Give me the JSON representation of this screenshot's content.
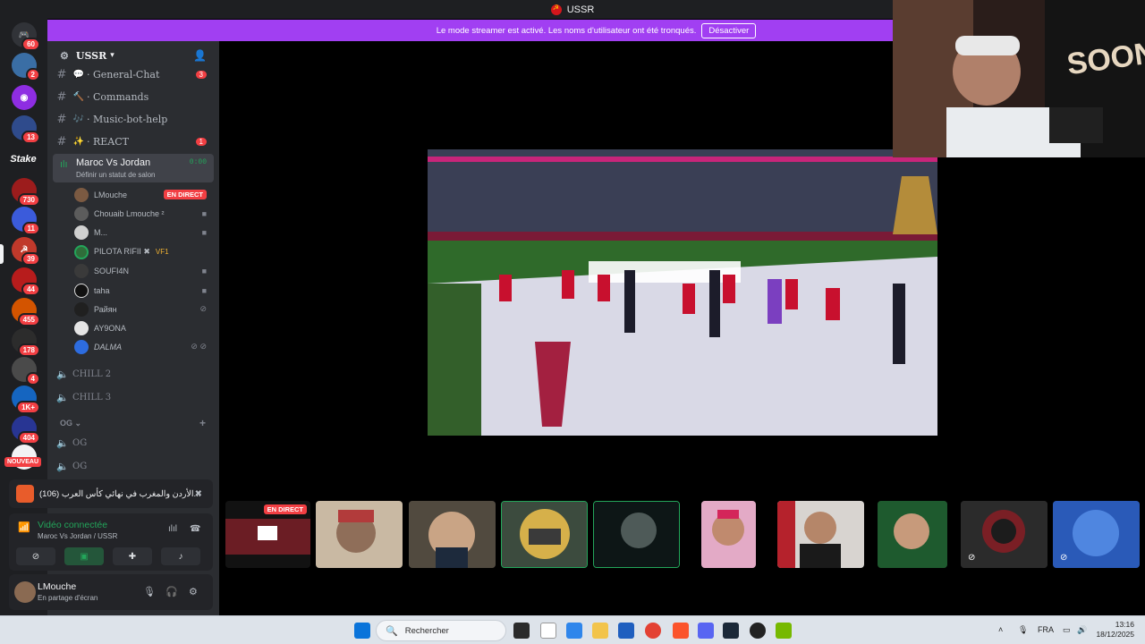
{
  "window": {
    "title": "USSR"
  },
  "banner": {
    "text": "Le mode streamer est activé. Les noms d'utilisateur ont été tronqués.",
    "button": "Désactiver"
  },
  "rail": {
    "badges": [
      "60",
      "2",
      "13",
      "730",
      "11",
      "39",
      "44",
      "455",
      "178",
      "4",
      "1K+",
      "404"
    ],
    "stake": "Stake",
    "new_label": "NOUVEAU"
  },
  "server": {
    "name": "USSR"
  },
  "channels": [
    {
      "emoji": "💬",
      "name": "· General-Chat",
      "count": "3"
    },
    {
      "emoji": "🔨",
      "name": "· Commands",
      "count": ""
    },
    {
      "emoji": "🎶",
      "name": "· Music-bot-help",
      "count": ""
    },
    {
      "emoji": "✨",
      "name": "· REACT",
      "count": "1"
    }
  ],
  "voice": {
    "name": "Maroc Vs Jordan",
    "time": "0:00",
    "status": "Définir un statut de salon",
    "users": [
      {
        "name": "LMouche",
        "live": "EN DIRECT",
        "icon": ""
      },
      {
        "name": "Chouaib Lmouche ²",
        "live": "",
        "icon": "camera-icon"
      },
      {
        "name": "M...",
        "live": "",
        "icon": "camera-icon"
      },
      {
        "name": "PILOTA RIFII ✖",
        "live": "",
        "icon": "",
        "extra": "VF1"
      },
      {
        "name": "SOUFI4N",
        "live": "",
        "icon": "camera-icon"
      },
      {
        "name": "taha",
        "live": "",
        "icon": "camera-icon"
      },
      {
        "name": "Райян",
        "live": "",
        "icon": "mute-icon"
      },
      {
        "name": "AY9ONA",
        "live": "",
        "icon": "camera-icon"
      },
      {
        "name": "DALMA",
        "live": "",
        "icon": "deafen-icon"
      }
    ]
  },
  "voice_channels": [
    "CHILL 2",
    "CHILL 3"
  ],
  "category": {
    "name": "OG",
    "channels": [
      "OG",
      "OG"
    ]
  },
  "activity": {
    "text": "الأردن والمغرب في نهائي كأس العرب (106)..."
  },
  "connection": {
    "title": "Vidéo connectée",
    "sub": "Maroc Vs Jordan / USSR"
  },
  "user": {
    "name": "LMouche",
    "status": "En partage d'écran"
  },
  "thumbs": {
    "live": "EN DIRECT"
  },
  "taskbar": {
    "search": "Rechercher",
    "lang": "FRA",
    "time": "13:16",
    "date": "18/12/2025"
  },
  "colors": {
    "accent": "#a13ff2",
    "green": "#23a55a",
    "red": "#f23f43"
  }
}
